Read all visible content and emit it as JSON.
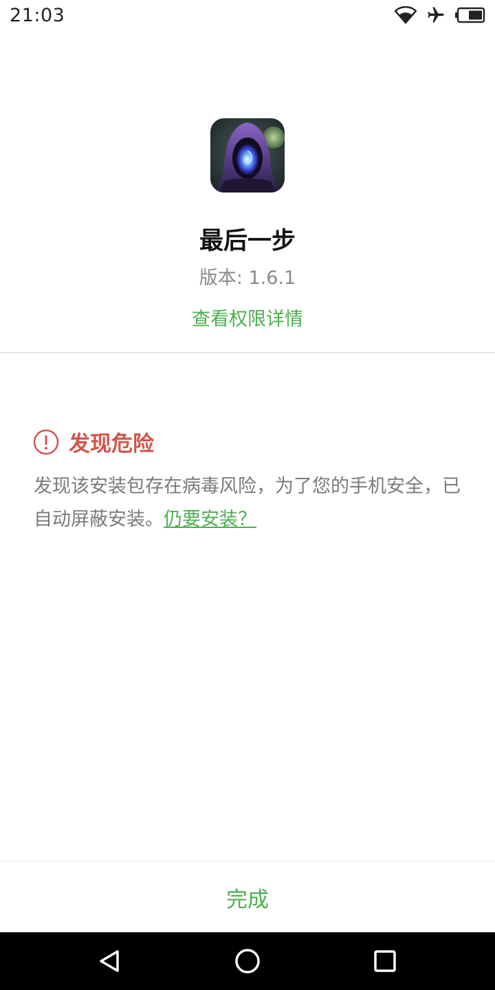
{
  "status_bar": {
    "time": "21:03",
    "icons": [
      "wifi-icon",
      "airplane-mode-icon",
      "battery-icon"
    ]
  },
  "app": {
    "name": "最后一步",
    "version": "版本: 1.6.1",
    "permission_link": "查看权限详情",
    "icon": "app-icon"
  },
  "danger": {
    "title": "发现危险",
    "message": "发现该安装包存在病毒风险，为了您的手机安全，已自动屏蔽安装。",
    "install_anyway": "仍要安装？",
    "icon": "alert-circle-icon"
  },
  "footer": {
    "done_label": "完成"
  },
  "nav": {
    "items": [
      "back-icon",
      "home-icon",
      "recents-icon"
    ]
  },
  "colors": {
    "accent": "#4caf50",
    "danger": "#d2544a",
    "text_secondary": "#7a7a7a",
    "nav_background": "#000000"
  }
}
